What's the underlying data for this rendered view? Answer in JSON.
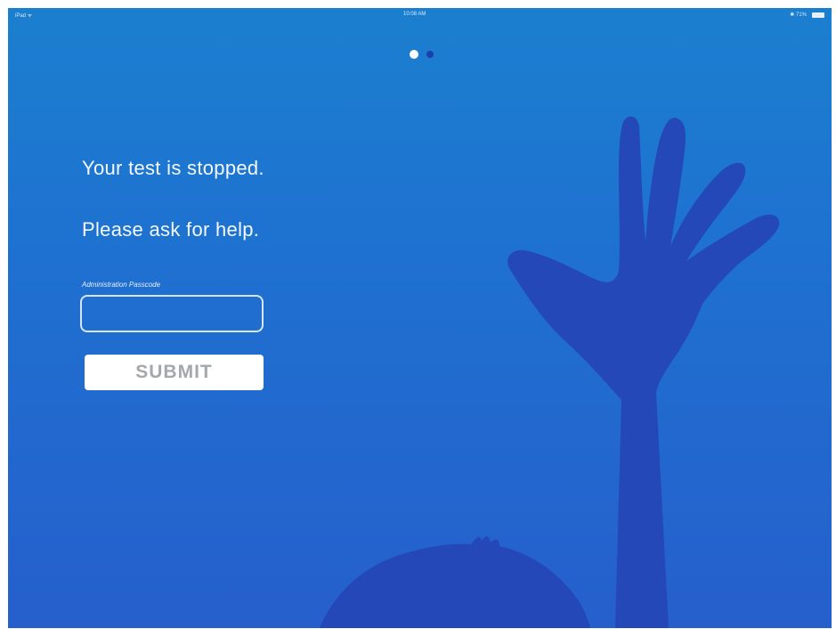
{
  "status_bar": {
    "carrier": "iPad ᯤ",
    "time": "10:08 AM",
    "battery": "✱ 71%"
  },
  "pager": {
    "pages": 2,
    "current": 1
  },
  "message": {
    "line1": "Your test is stopped.",
    "line2": "Please ask for help."
  },
  "passcode": {
    "label": "Administration Passcode",
    "value": "",
    "placeholder": ""
  },
  "submit": {
    "label": "SUBMIT"
  },
  "icons": {
    "hand": "raised-hand-icon",
    "head": "head-silhouette-icon",
    "battery": "battery-icon"
  },
  "colors": {
    "background_top": "#1b7fcf",
    "background_bottom": "#265fcc",
    "silhouette": "#2448b8",
    "text": "#f4f8fd",
    "button_text": "#a3a8ad"
  }
}
